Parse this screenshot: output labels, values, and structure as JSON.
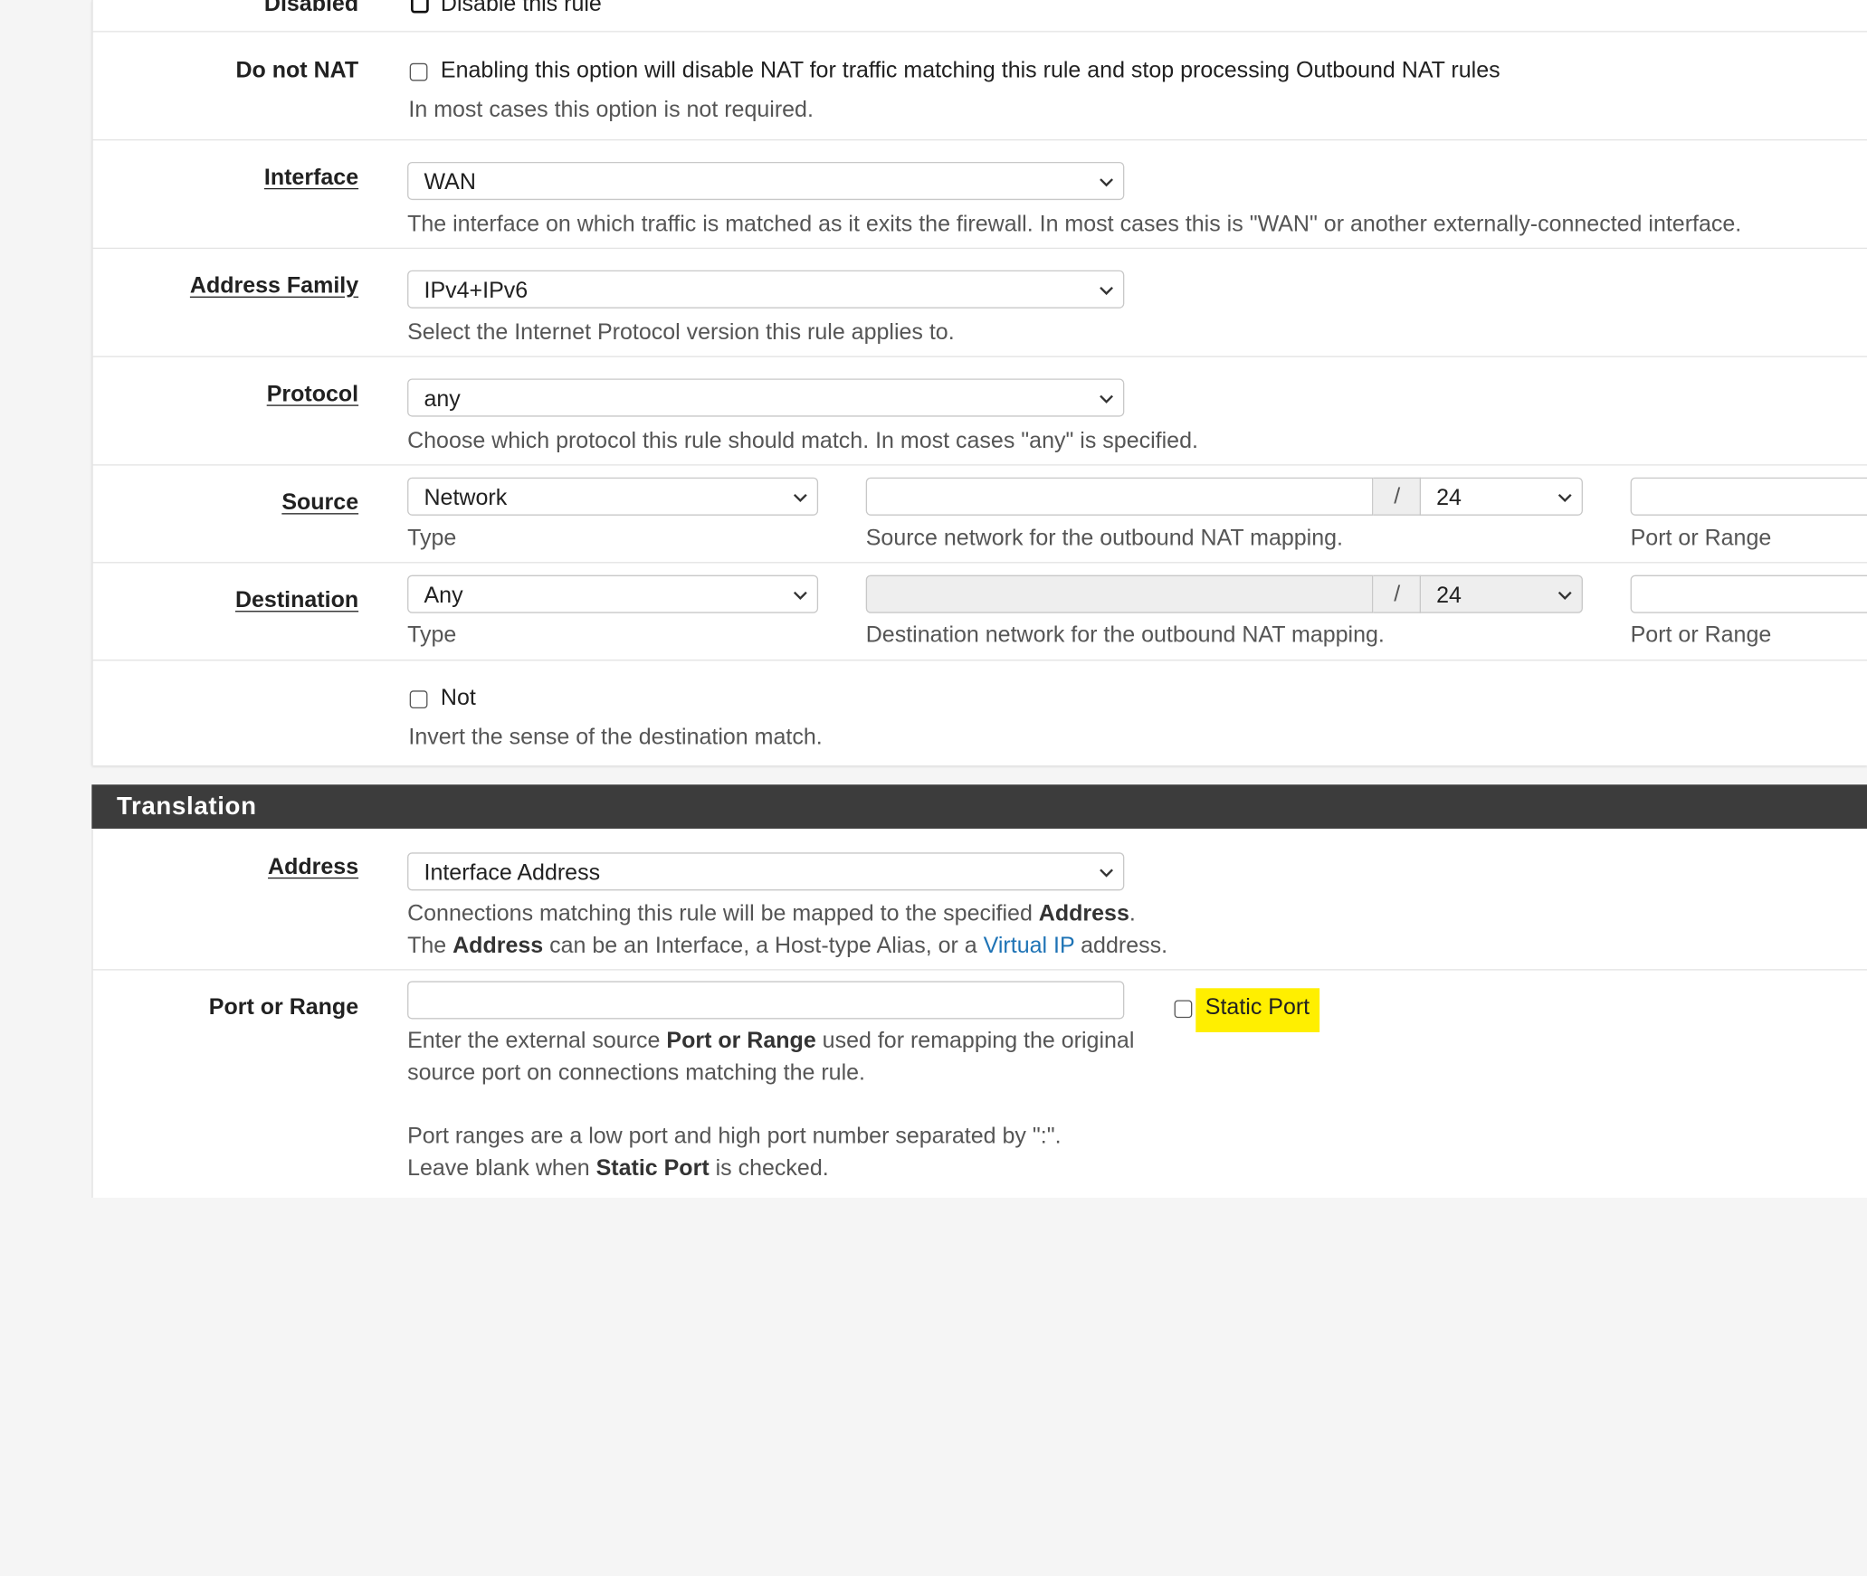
{
  "rows": {
    "disabled": {
      "label": "Disabled",
      "checkbox_label": "Disable this rule"
    },
    "do_not_nat": {
      "label": "Do not NAT",
      "checkbox_label": "Enabling this option will disable NAT for traffic matching this rule and stop processing Outbound NAT rules",
      "help": "In most cases this option is not required."
    },
    "interface": {
      "label": "Interface",
      "value": "WAN",
      "help": "The interface on which traffic is matched as it exits the firewall. In most cases this is \"WAN\" or another externally-connected interface."
    },
    "address_family": {
      "label": "Address Family",
      "value": "IPv4+IPv6",
      "help": "Select the Internet Protocol version this rule applies to."
    },
    "protocol": {
      "label": "Protocol",
      "value": "any",
      "help": "Choose which protocol this rule should match. In most cases \"any\" is specified."
    },
    "source": {
      "label": "Source",
      "type_value": "Network",
      "type_help": "Type",
      "network_value": "",
      "network_help": "Source network for the outbound NAT mapping.",
      "slash": "/",
      "mask_value": "24",
      "port_help": "Port or Range"
    },
    "destination": {
      "label": "Destination",
      "type_value": "Any",
      "type_help": "Type",
      "network_value": "",
      "network_help": "Destination network for the outbound NAT mapping.",
      "slash": "/",
      "mask_value": "24",
      "port_help": "Port or Range"
    },
    "not": {
      "checkbox_label": "Not",
      "help": "Invert the sense of the destination match."
    }
  },
  "translation": {
    "heading": "Translation",
    "address": {
      "label": "Address",
      "value": "Interface Address",
      "help1_pre": "Connections matching this rule will be mapped to the specified ",
      "help1_bold": "Address",
      "help1_post": ".",
      "help2_pre": "The ",
      "help2_bold": "Address",
      "help2_mid": " can be an Interface, a Host-type Alias, or a ",
      "help2_link": "Virtual IP",
      "help2_post": " address."
    },
    "port_or_range": {
      "label": "Port or Range",
      "value": "",
      "static_port_label": "Static Port",
      "help1_pre": "Enter the external source ",
      "help1_bold": "Port or Range",
      "help1_post": " used for remapping the original",
      "help2": "source port on connections matching the rule.",
      "help3": "Port ranges are a low port and high port number separated by \":\".",
      "help4_pre": "Leave blank when ",
      "help4_bold": "Static Port",
      "help4_post": " is checked."
    }
  },
  "colors": {
    "section_header_bg": "#3c3c3c",
    "highlight": "#ffef00",
    "link": "#1e73b5"
  },
  "icons": {
    "select_arrow": "chevron-down-icon"
  }
}
